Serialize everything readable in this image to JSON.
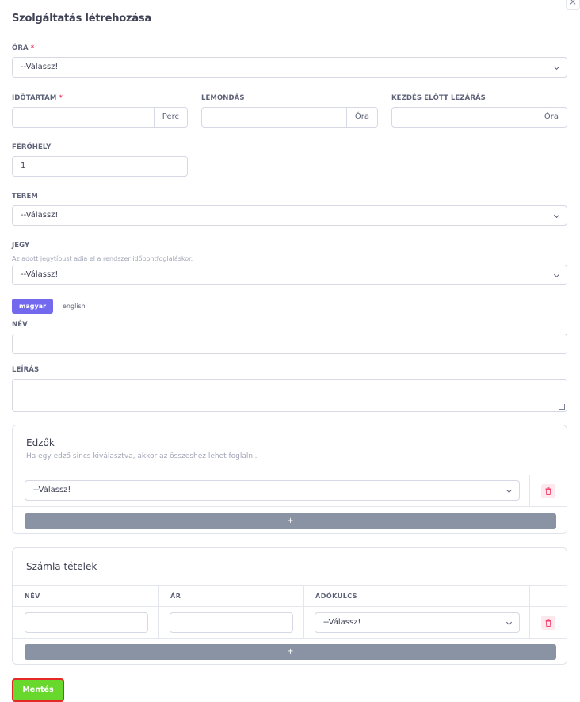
{
  "dialog": {
    "title": "Szolgáltatás létrehozása",
    "close_label": "×"
  },
  "fields": {
    "ora": {
      "label": "ÓRA",
      "required_mark": "*",
      "value": "--Válassz!"
    },
    "idotartam": {
      "label": "IDŐTARTAM",
      "required_mark": "*",
      "value": "",
      "addon": "Perc"
    },
    "lemondas": {
      "label": "LEMONDÁS",
      "value": "",
      "addon": "Óra"
    },
    "kezdes_elott_lezaras": {
      "label": "KEZDÉS ELŐTT LEZÁRÁS",
      "value": "",
      "addon": "Óra"
    },
    "ferohely": {
      "label": "FÉRŐHELY",
      "value": "1"
    },
    "terem": {
      "label": "TEREM",
      "value": "--Válassz!"
    },
    "jegy": {
      "label": "JEGY",
      "help": "Az adott jegytípust adja el a rendszer időpontfoglaláskor.",
      "value": "--Válassz!"
    },
    "nev": {
      "label": "NÉV",
      "value": ""
    },
    "leiras": {
      "label": "LEÍRÁS",
      "value": ""
    }
  },
  "language_tabs": [
    {
      "label": "magyar",
      "active": true
    },
    {
      "label": "english",
      "active": false
    }
  ],
  "edzok": {
    "title": "Edzők",
    "subtitle": "Ha egy edző sincs kiválasztva, akkor az összeshez lehet foglalni.",
    "rows": [
      {
        "value": "--Válassz!"
      }
    ],
    "add_label": "+"
  },
  "szamla": {
    "title": "Számla tételek",
    "columns": [
      "NÉV",
      "ÁR",
      "ADÓKULCS"
    ],
    "rows": [
      {
        "nev": "",
        "ar": "",
        "adokulcs": "--Válassz!"
      }
    ],
    "add_label": "+"
  },
  "save_label": "Mentés",
  "colors": {
    "accent": "#7269ef",
    "save": "#68d82d",
    "save_border": "#e42727",
    "danger": "#f1416c",
    "add_bar": "#8a93a3"
  }
}
